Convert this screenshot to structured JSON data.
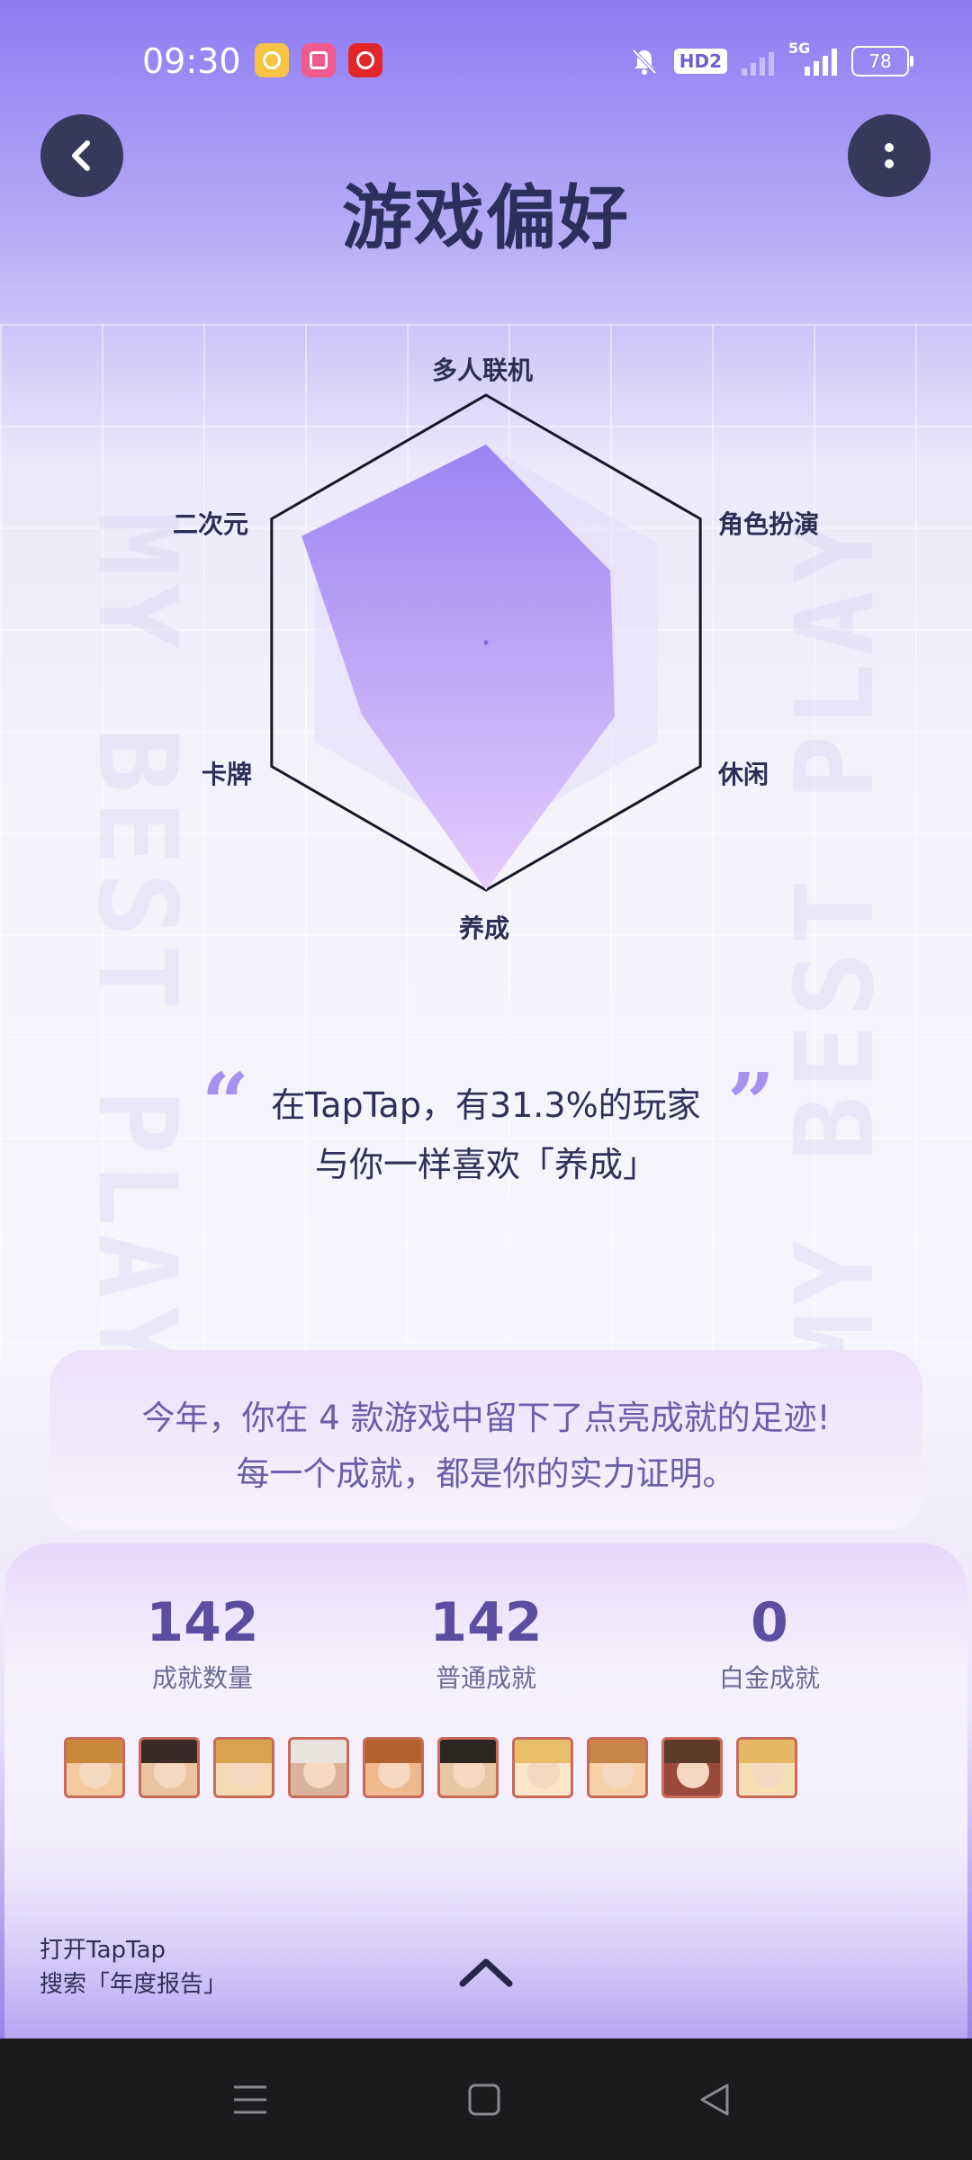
{
  "status_bar": {
    "time": "09:30",
    "icons": [
      "weibo-icon",
      "bilibili-icon",
      "netease-music-icon",
      "mute-bell-icon",
      "hd-voice-icon",
      "signal-icon",
      "5g-signal-icon",
      "battery-icon"
    ],
    "hd_label": "HD2",
    "network": "5G",
    "battery": "78"
  },
  "header": {
    "title": "游戏偏好"
  },
  "radar": {
    "axes": [
      "多人联机",
      "角色扮演",
      "休闲",
      "养成",
      "卡牌",
      "二次元"
    ],
    "values": [
      0.8,
      0.58,
      0.6,
      1.0,
      0.58,
      0.86
    ],
    "fill_top": "#9b84f2",
    "fill_bottom": "#e6ccfd"
  },
  "quote": {
    "line1": "在TapTap，有31.3%的玩家",
    "line2": "与你一样喜欢「养成」",
    "open_mark": "“",
    "close_mark": "”"
  },
  "summary": {
    "line1": "今年，你在 4 款游戏中留下了点亮成就的足迹!",
    "line2": "每一个成就，都是你的实力证明。"
  },
  "stats": [
    {
      "value": "142",
      "label": "成就数量"
    },
    {
      "value": "142",
      "label": "普通成就"
    },
    {
      "value": "0",
      "label": "白金成就"
    }
  ],
  "achievement_badges": [
    {
      "hair": "#c9883a",
      "bg": "#f3c9a0"
    },
    {
      "hair": "#3b2a26",
      "bg": "#e9c49f"
    },
    {
      "hair": "#d8a24e",
      "bg": "#f6d9b4"
    },
    {
      "hair": "#e9e2dc",
      "bg": "#d9b39a"
    },
    {
      "hair": "#b3622e",
      "bg": "#eeb98d"
    },
    {
      "hair": "#2d2722",
      "bg": "#e7c7a3"
    },
    {
      "hair": "#e6bf68",
      "bg": "#fbe6c8"
    },
    {
      "hair": "#c98448",
      "bg": "#f7d1aa"
    },
    {
      "hair": "#5e3a2a",
      "bg": "#9a4a3a"
    },
    {
      "hair": "#e5b865",
      "bg": "#f7dfb5"
    }
  ],
  "footer_hint": {
    "line1": "打开TapTap",
    "line2": "搜索「年度报告」"
  },
  "nav": {
    "icons": [
      "menu-icon",
      "home-icon",
      "back-triangle-icon"
    ]
  },
  "watermark": "MY BEST PLAY"
}
